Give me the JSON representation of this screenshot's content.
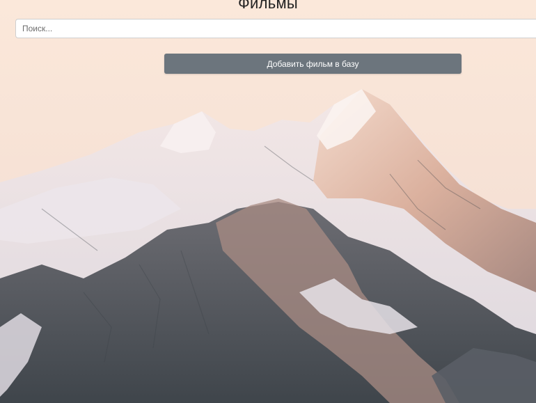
{
  "header": {
    "title": "Фильмы"
  },
  "search": {
    "placeholder": "Поиск..."
  },
  "actions": {
    "add_movie_label": "Добавить фильм в базу"
  },
  "background": {
    "scene": "snowy-mountain-peaks",
    "colors": {
      "sky_top": "#fbe7d9",
      "snow": "#ece6ea",
      "rock_dark": "#4b4f55",
      "rock_warm": "#b08b7a"
    }
  }
}
